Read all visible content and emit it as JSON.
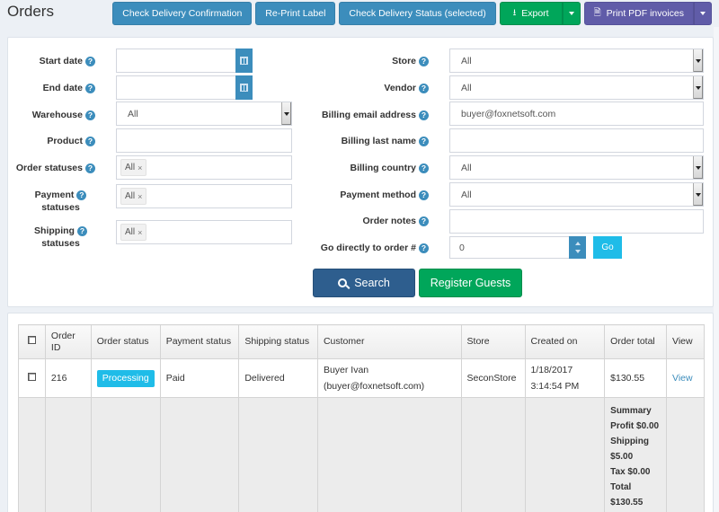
{
  "header": {
    "title": "Orders"
  },
  "toolbar": {
    "check_delivery_confirmation": "Check Delivery Confirmation",
    "reprint_label": "Re-Print Label",
    "check_delivery_status": "Check Delivery Status (selected)",
    "export": "Export",
    "print_pdf": "Print PDF invoices"
  },
  "filters": {
    "left": {
      "start_date": {
        "label": "Start date",
        "value": ""
      },
      "end_date": {
        "label": "End date",
        "value": ""
      },
      "warehouse": {
        "label": "Warehouse",
        "value": "All"
      },
      "product": {
        "label": "Product",
        "value": ""
      },
      "order_statuses": {
        "label": "Order statuses",
        "tag": "All"
      },
      "payment_statuses": {
        "label_line1": "Payment",
        "label_line2": "statuses",
        "tag": "All"
      },
      "shipping_statuses": {
        "label_line1": "Shipping",
        "label_line2": "statuses",
        "tag": "All"
      }
    },
    "right": {
      "store": {
        "label": "Store",
        "value": "All"
      },
      "vendor": {
        "label": "Vendor",
        "value": "All"
      },
      "billing_email": {
        "label": "Billing email address",
        "value": "buyer@foxnetsoft.com"
      },
      "billing_last_name": {
        "label": "Billing last name",
        "value": ""
      },
      "billing_country": {
        "label": "Billing country",
        "value": "All"
      },
      "payment_method": {
        "label": "Payment method",
        "value": "All"
      },
      "order_notes": {
        "label": "Order notes",
        "value": ""
      },
      "go_to_order": {
        "label": "Go directly to order #",
        "value": "0",
        "go_label": "Go"
      }
    },
    "help_glyph": "?",
    "tag_remove_glyph": "×",
    "search_label": "Search",
    "register_guests_label": "Register Guests"
  },
  "grid": {
    "columns": [
      "Order ID",
      "Order status",
      "Payment status",
      "Shipping status",
      "Customer",
      "Store",
      "Created on",
      "Order total",
      "View"
    ],
    "rows": [
      {
        "order_id": "216",
        "order_status": "Processing",
        "payment_status": "Paid",
        "shipping_status": "Delivered",
        "customer_name": "Buyer Ivan",
        "customer_email": "(buyer@foxnetsoft.com)",
        "store": "SeconStore",
        "created_date": "1/18/2017",
        "created_time": "3:14:54 PM",
        "order_total": "$130.55",
        "view": "View"
      }
    ],
    "summary": {
      "lines": [
        "Summary",
        "Profit $0.00",
        "Shipping",
        "$5.00",
        "Tax $0.00",
        "Total",
        "$130.55"
      ]
    }
  },
  "colors": {
    "primary": "#3c8dbc",
    "success": "#00a65a",
    "purple": "#605ca8",
    "info": "#1fbce8",
    "search": "#2e5e8e"
  }
}
